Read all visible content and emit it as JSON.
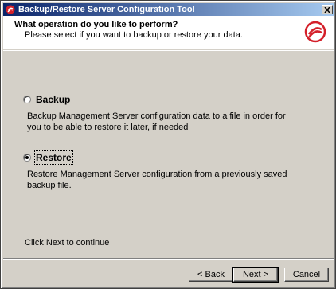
{
  "window": {
    "title": "Backup/Restore Server Configuration Tool",
    "close_icon": "close-icon"
  },
  "header": {
    "title": "What operation do you like to perform?",
    "subtitle": "Please select if you want to backup or restore your data.",
    "logo_icon": "brand-logo"
  },
  "options": [
    {
      "label": "Backup",
      "checked": false,
      "description": "Backup Management Server configuration data to a file in order for you to be able to restore it later, if needed"
    },
    {
      "label": "Restore",
      "checked": true,
      "description": "Restore Management Server configuration from a previously saved backup file."
    }
  ],
  "footer": {
    "hint": "Click Next to continue"
  },
  "buttons": {
    "back": "< Back",
    "next": "Next >",
    "cancel": "Cancel"
  },
  "colors": {
    "titlebar_start": "#0a246a",
    "titlebar_end": "#a6caf0",
    "dialog_bg": "#d4d0c8",
    "logo_red": "#d4202a"
  }
}
